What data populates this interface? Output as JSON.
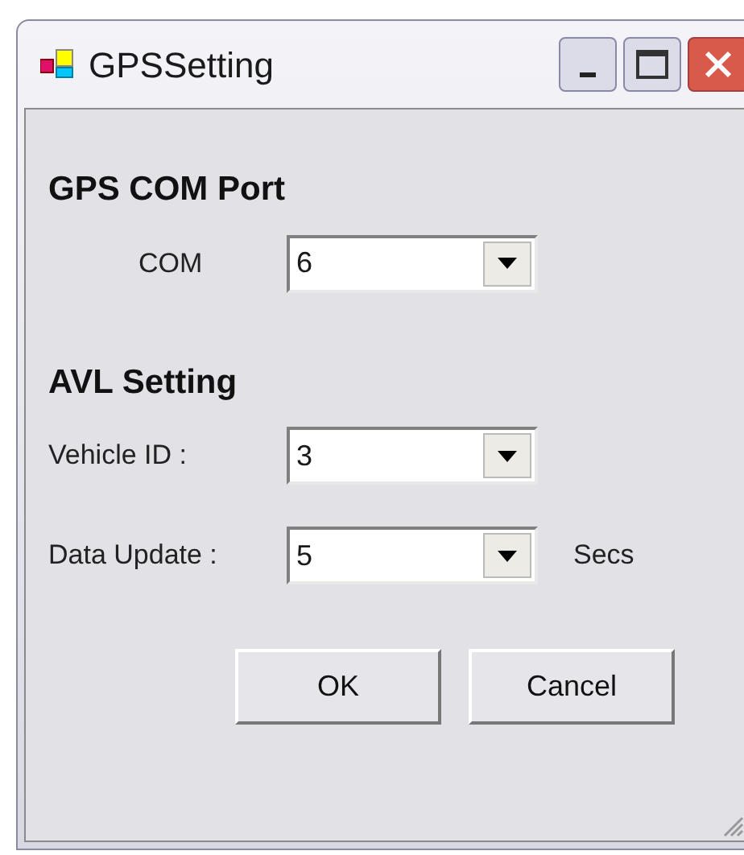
{
  "window": {
    "title": "GPSSetting"
  },
  "sections": [
    {
      "heading": "GPS COM Port",
      "fields": [
        {
          "label": "COM",
          "value": "6"
        }
      ]
    },
    {
      "heading": "AVL Setting",
      "fields": [
        {
          "label": "Vehicle ID :",
          "value": "3"
        },
        {
          "label": "Data Update :",
          "value": "5",
          "unit": "Secs"
        }
      ]
    }
  ],
  "buttons": [
    "OK",
    "Cancel"
  ]
}
